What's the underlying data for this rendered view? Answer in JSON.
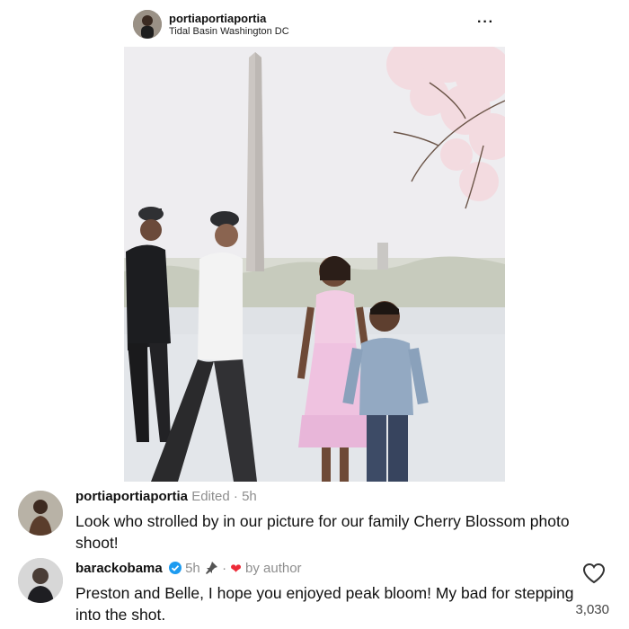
{
  "post": {
    "username": "portiaportiaportia",
    "location": "Tidal Basin Washington DC",
    "more_label": "···"
  },
  "comments": [
    {
      "username": "portiaportiaportia",
      "edited": "Edited",
      "separator": "·",
      "time": "5h",
      "text": "Look who strolled by in our picture for our family Cherry Blossom photo shoot!"
    },
    {
      "username": "barackobama",
      "time": "5h",
      "separator": "·",
      "liked_by": "by author",
      "text": "Preston and Belle, I hope you enjoyed peak bloom! My bad for stepping into the shot.",
      "like_count": "3,030"
    }
  ],
  "colors": {
    "verified": "#1d9bf0",
    "author_heart": "#ed2b38",
    "meta_text": "#8e8e8e"
  },
  "icons": [
    "more-icon",
    "verified-badge-icon",
    "pin-icon",
    "author-heart-icon",
    "like-heart-icon"
  ]
}
